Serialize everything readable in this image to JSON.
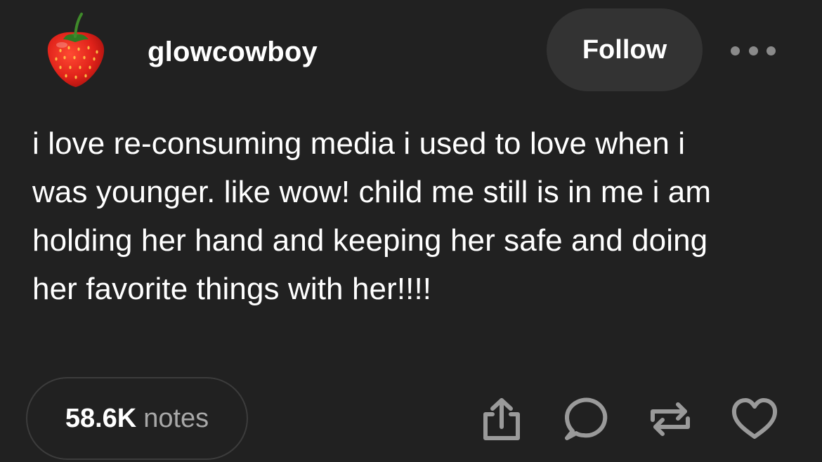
{
  "post": {
    "username": "glowcowboy",
    "follow_label": "Follow",
    "body_lines": [
      "i love re-consuming media i used to love when i",
      "was younger. like wow! child me still is in me i am",
      "holding her hand and keeping her safe and doing",
      "her favorite things with her!!!!"
    ],
    "notes_count": "58.6K",
    "notes_label": "notes"
  },
  "icons": {
    "avatar": "strawberry-avatar",
    "more": "more-options-icon",
    "share": "share-icon",
    "reply": "reply-icon",
    "reblog": "reblog-icon",
    "like": "heart-icon"
  },
  "colors": {
    "background": "#212121",
    "button_bg": "#333333",
    "text": "#ffffff",
    "muted_text": "#a8a8a8",
    "icon": "#9a9a9a"
  }
}
